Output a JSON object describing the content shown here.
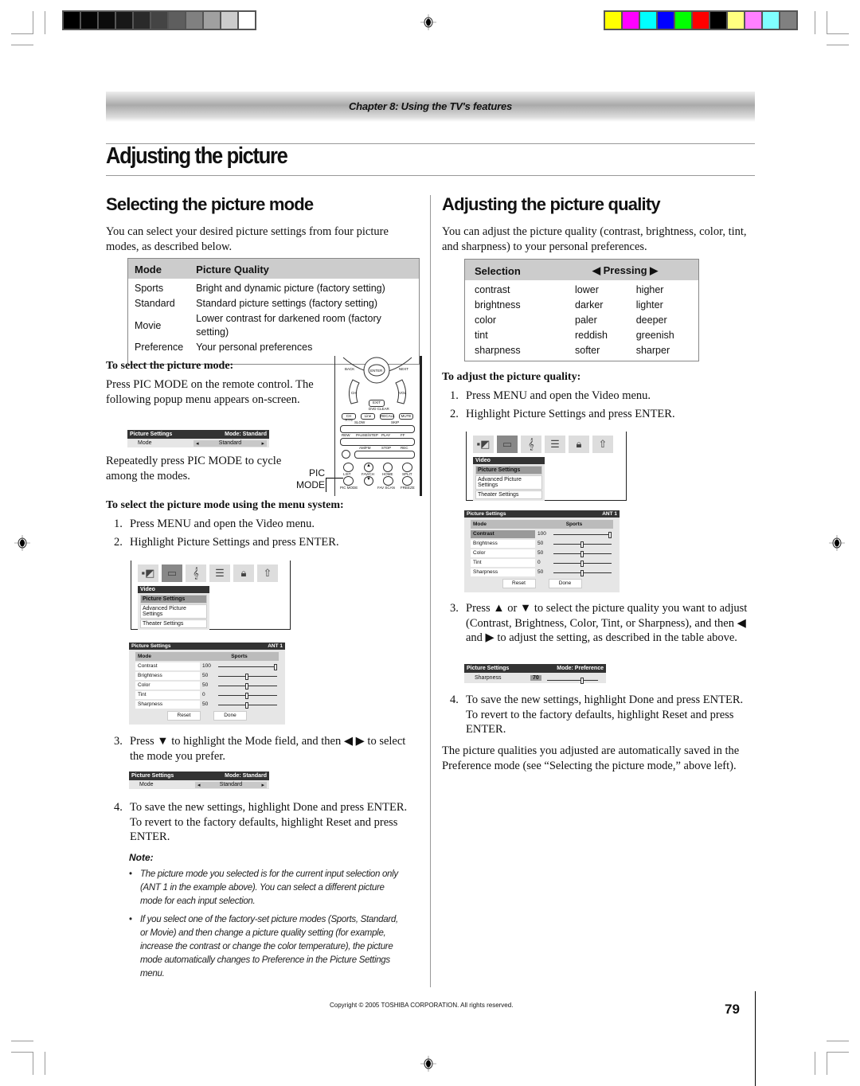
{
  "print_marks": {
    "gray_swatches": [
      "#000000",
      "#050505",
      "#0c0c0c",
      "#181818",
      "#2a2a2a",
      "#444444",
      "#5e5e5e",
      "#808080",
      "#a0a0a0",
      "#cccccc",
      "#ffffff"
    ],
    "color_swatches": [
      "#ffff00",
      "#ff00ff",
      "#00ffff",
      "#0000ff",
      "#00ff00",
      "#ff0000",
      "#000000",
      "#ffff80",
      "#ff80ff",
      "#80ffff",
      "#808080"
    ]
  },
  "header": {
    "chapter": "Chapter 8: Using the TV's features",
    "page_title": "Adjusting the picture"
  },
  "left": {
    "heading": "Selecting the picture mode",
    "intro": "You can select your desired picture settings from four picture modes, as described below.",
    "mode_table": {
      "headers": [
        "Mode",
        "Picture Quality"
      ],
      "rows": [
        [
          "Sports",
          "Bright and dynamic picture (factory setting)"
        ],
        [
          "Standard",
          "Standard picture settings (factory setting)"
        ],
        [
          "Movie",
          "Lower contrast for darkened room (factory setting)"
        ],
        [
          "Preference",
          "Your personal preferences"
        ]
      ]
    },
    "sub1": "To select the picture mode:",
    "sub1_text": "Press PIC MODE on the remote control. The following popup menu appears on-screen.",
    "popup": {
      "title": "Picture Settings",
      "status": "Mode: Standard",
      "field": "Mode",
      "value": "Standard"
    },
    "sub1_text2": "Repeatedly press PIC MODE to cycle among the modes.",
    "pic_mode_callout": [
      "PIC",
      "MODE"
    ],
    "remote": {
      "labels": [
        "BACK",
        "ENTER",
        "NEXT",
        "CH",
        "VOL",
        "EXIT",
        "DVD CLEAR",
        "TV/CABLE",
        "CH RTN",
        "Line",
        "RECALL",
        "MUTE",
        "SLOW",
        "SKIP",
        "REW",
        "PAUSE/STEP",
        "PLAY",
        "FF",
        "AM/FM",
        "STOP",
        "REC",
        "DISC",
        "LIST",
        "FAV/CH",
        "HOME",
        "SPLIT",
        "PIC MODE",
        "FAV SCAN",
        "FREEZE"
      ]
    },
    "sub2": "To select the picture mode using the menu system:",
    "steps": [
      {
        "n": "1.",
        "text": "Press MENU and open the Video menu."
      },
      {
        "n": "2.",
        "text": "Highlight Picture Settings and press ENTER."
      }
    ],
    "video_menu": {
      "title": "Video",
      "items": [
        "Picture Settings",
        "Advanced Picture Settings",
        "Theater Settings"
      ],
      "selected": 0
    },
    "picture_settings": {
      "title": "Picture Settings",
      "input": "ANT 1",
      "mode_label": "Mode",
      "mode_value": "Sports",
      "rows": [
        {
          "name": "Contrast",
          "value": "100",
          "pct": 1.0
        },
        {
          "name": "Brightness",
          "value": "50",
          "pct": 0.5
        },
        {
          "name": "Color",
          "value": "50",
          "pct": 0.5
        },
        {
          "name": "Tint",
          "value": "0",
          "pct": 0.5
        },
        {
          "name": "Sharpness",
          "value": "50",
          "pct": 0.5
        }
      ],
      "reset": "Reset",
      "done": "Done"
    },
    "steps2": [
      {
        "n": "3.",
        "text": "Press ▼ to highlight the Mode field, and then ◀ ▶ to select the mode you prefer."
      }
    ],
    "popup2": {
      "title": "Picture Settings",
      "status": "Mode: Standard",
      "field": "Mode",
      "value": "Standard"
    },
    "steps3": [
      {
        "n": "4.",
        "text": "To save the new settings, highlight Done and press ENTER. To revert to the factory defaults, highlight Reset and press ENTER."
      }
    ],
    "note_heading": "Note:",
    "notes": [
      "The picture mode you selected is for the current input selection only (ANT 1 in the example above). You can select a different picture mode for each input selection.",
      "If you select one of the factory-set picture modes (Sports, Standard, or Movie) and then change a picture quality setting (for example, increase the contrast or change the color temperature), the picture mode automatically changes to Preference in the Picture Settings menu."
    ]
  },
  "right": {
    "heading": "Adjusting the picture quality",
    "intro": "You can adjust the picture quality (contrast, brightness, color, tint, and sharpness) to your personal preferences.",
    "quality_table": {
      "headers": [
        "Selection",
        "◀ Pressing ▶"
      ],
      "rows": [
        [
          "contrast",
          "lower",
          "higher"
        ],
        [
          "brightness",
          "darker",
          "lighter"
        ],
        [
          "color",
          "paler",
          "deeper"
        ],
        [
          "tint",
          "reddish",
          "greenish"
        ],
        [
          "sharpness",
          "softer",
          "sharper"
        ]
      ]
    },
    "sub": "To adjust the picture quality:",
    "steps": [
      {
        "n": "1.",
        "text": "Press MENU and open the Video menu."
      },
      {
        "n": "2.",
        "text": "Highlight Picture Settings and press ENTER."
      }
    ],
    "video_menu": {
      "title": "Video",
      "items": [
        "Picture Settings",
        "Advanced Picture Settings",
        "Theater Settings"
      ],
      "selected": 0
    },
    "picture_settings": {
      "title": "Picture Settings",
      "input": "ANT 1",
      "mode_label": "Mode",
      "mode_value": "Sports",
      "highlighted": "Contrast",
      "rows": [
        {
          "name": "Contrast",
          "value": "100",
          "pct": 1.0
        },
        {
          "name": "Brightness",
          "value": "50",
          "pct": 0.5
        },
        {
          "name": "Color",
          "value": "50",
          "pct": 0.5
        },
        {
          "name": "Tint",
          "value": "0",
          "pct": 0.5
        },
        {
          "name": "Sharpness",
          "value": "50",
          "pct": 0.5
        }
      ],
      "reset": "Reset",
      "done": "Done"
    },
    "steps2": [
      {
        "n": "3.",
        "text": "Press ▲ or ▼ to select the picture quality you want to adjust (Contrast, Brightness, Color, Tint, or Sharpness), and then ◀ and ▶ to adjust the setting, as described in the table above."
      }
    ],
    "sharp_popup": {
      "title": "Picture Settings",
      "status": "Mode: Preference",
      "field": "Sharpness",
      "value": "70",
      "pct": 0.7
    },
    "steps3": [
      {
        "n": "4.",
        "text": "To save the new settings, highlight Done and press ENTER. To revert to the factory defaults, highlight Reset and press ENTER."
      }
    ],
    "closing": "The picture qualities you adjusted are automatically saved in the Preference mode (see “Selecting the picture mode,” above left)."
  },
  "footer": {
    "copyright": "Copyright © 2005 TOSHIBA CORPORATION. All rights reserved.",
    "page_number": "79"
  }
}
